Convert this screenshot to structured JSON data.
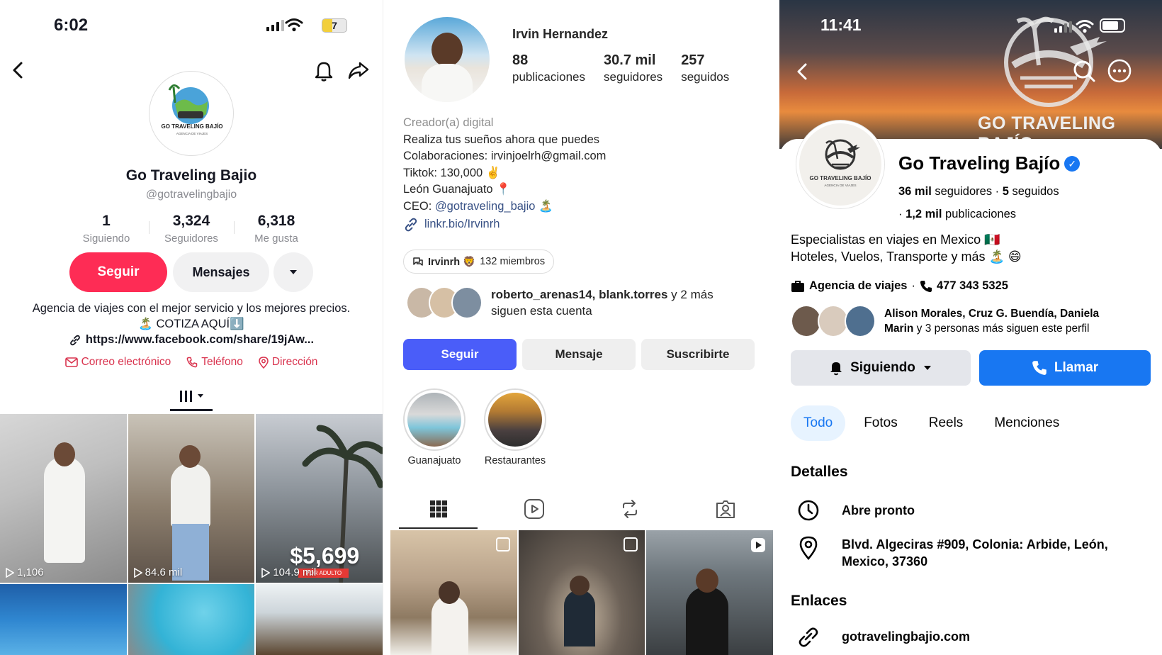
{
  "tiktok": {
    "status_time": "6:02",
    "battery": "7",
    "name": "Go Traveling Bajio",
    "handle": "@gotravelingbajio",
    "avatar_text": "GO TRAVELING BAJÍO",
    "stats": [
      {
        "value": "1",
        "label": "Siguiendo"
      },
      {
        "value": "3,324",
        "label": "Seguidores"
      },
      {
        "value": "6,318",
        "label": "Me gusta"
      }
    ],
    "follow_label": "Seguir",
    "message_label": "Mensajes",
    "bio": "Agencia de viajes con el mejor servicio y los mejores precios. 🏝️ COTIZA AQUÍ⬇️",
    "link": "https://www.facebook.com/share/19jAw...",
    "contacts": [
      "Correo electrónico",
      "Teléfono",
      "Dirección"
    ],
    "videos": [
      {
        "views": "1,106"
      },
      {
        "views": "84.6 mil"
      },
      {
        "views": "104.9 mil",
        "price": "$5,699",
        "price_note": "POR ADULTO"
      },
      {
        "views": ""
      },
      {
        "views": ""
      },
      {
        "views": ""
      }
    ],
    "colors": {
      "accent": "#fe2c55",
      "contact": "#d9334e"
    }
  },
  "instagram": {
    "name": "Irvin Hernandez",
    "stats": [
      {
        "value": "88",
        "label": "publicaciones"
      },
      {
        "value": "30.7 mil",
        "label": "seguidores"
      },
      {
        "value": "257",
        "label": "seguidos"
      }
    ],
    "category": "Creador(a) digital",
    "bio_lines": [
      "Realiza tus sueños ahora que puedes",
      "Colaboraciones: irvinjoelrh@gmail.com",
      "Tiktok: 130,000 ✌️",
      "León Guanajuato 📍"
    ],
    "ceo_prefix": "CEO: ",
    "ceo_mention": "@gotraveling_bajio",
    "ceo_emoji": " 🏝️",
    "link": "linkr.bio/Irvinrh",
    "channel_name": "Irvinrh 🦁",
    "channel_members": "132 miembros",
    "followed_by_names": "roberto_arenas14, blank.torres",
    "followed_by_more": " y 2 más",
    "followed_by_tail": "siguen esta cuenta",
    "follow_label": "Seguir",
    "message_label": "Mensaje",
    "subscribe_label": "Suscribirte",
    "highlights": [
      "Guanajuato",
      "Restaurantes"
    ],
    "colors": {
      "accent": "#4a5df9",
      "link": "#385185"
    }
  },
  "facebook": {
    "status_time": "11:41",
    "cover_brand": "GO TRAVELING BAJÍO",
    "avatar_text": "GO TRAVELING BAJÍO",
    "avatar_sub": "AGENCIA DE VIAJES",
    "name": "Go Traveling Bajío",
    "followers_count": "36 mil",
    "followers_label": " seguidores",
    "following_count": "5",
    "following_label": " seguidos",
    "posts_count": "1,2 mil",
    "posts_label": " publicaciones",
    "bio_lines": [
      "Especialistas en viajes en Mexico 🇲🇽",
      "Hoteles, Vuelos, Transporte y más 🏝️ 😄"
    ],
    "category": "Agencia de viajes",
    "phone": "477 343 5325",
    "mutual_names": "Alison Morales, Cruz G. Buendía, Daniela Marin",
    "mutual_tail": " y 3 personas más siguen este perfil",
    "following_button": "Siguiendo",
    "call_button": "Llamar",
    "tabs": [
      "Todo",
      "Fotos",
      "Reels",
      "Menciones"
    ],
    "details_heading": "Detalles",
    "hours": "Abre pronto",
    "address": "Blvd. Algeciras #909, Colonia: Arbide, León, Mexico, 37360",
    "links_heading": "Enlaces",
    "website": "gotravelingbajio.com",
    "colors": {
      "accent": "#1877f2"
    }
  }
}
